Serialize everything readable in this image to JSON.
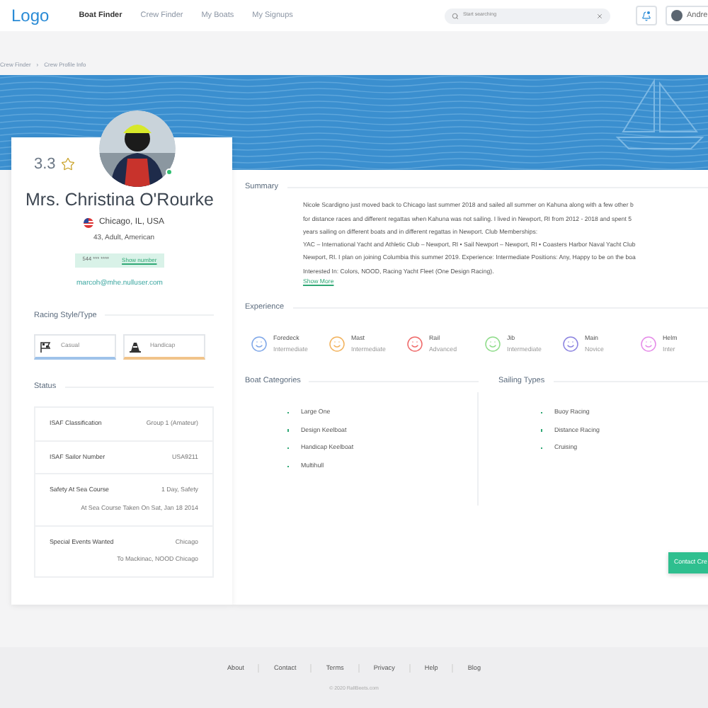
{
  "header": {
    "logo": "Logo",
    "nav": [
      {
        "label": "Boat Finder",
        "selected": true
      },
      {
        "label": "Crew Finder",
        "selected": false
      },
      {
        "label": "My Boats",
        "selected": false
      },
      {
        "label": "My Signups",
        "selected": false
      }
    ],
    "search": {
      "placeholder": "Start searching"
    },
    "user": {
      "name": "Andre"
    }
  },
  "breadcrumb": [
    "Crew Finder",
    "›",
    "Crew Profile Info"
  ],
  "profile": {
    "rating": "3.3",
    "name": "Mrs. Christina O'Rourke",
    "location": "Chicago, IL, USA",
    "details": "43, Adult, American",
    "phone": "544 *** ****",
    "show_number": "Show number",
    "email": "marcoh@mhe.nulluser.com",
    "online": true
  },
  "racing_style": {
    "title": "Racing Style/Type",
    "items": [
      {
        "label": "Casual",
        "color": "#9fc3ea",
        "kind": "flag"
      },
      {
        "label": "Handicap",
        "color": "#f1c48a",
        "kind": "cone"
      }
    ]
  },
  "status": {
    "title": "Status",
    "rows": [
      {
        "label": "ISAF Classification",
        "value": "Group 1 (Amateur)"
      },
      {
        "label": "ISAF Sailor Number",
        "value": "USA9211"
      },
      {
        "label": "Safety At Sea Course",
        "value": "1 Day, Safety",
        "value_2": "At Sea Course Taken On Sat, Jan 18 2014"
      },
      {
        "label": "Special Events Wanted",
        "value": "Chicago",
        "value_2": "To Mackinac, NOOD Chicago"
      }
    ]
  },
  "summary": {
    "title": "Summary",
    "lines": [
      "Nicole Scardigno just moved back to Chicago last summer 2018 and sailed all summer on Kahuna along with a few other b",
      "for distance races and different regattas when Kahuna was not sailing. I lived in Newport, RI from 2012 - 2018 and spent 5",
      "years sailing on different boats and in different regattas in Newport. Club Memberships:",
      "YAC – International Yacht and Athletic Club – Newport, RI • Sail Newport – Newport, RI • Coasters Harbor Naval Yacht Club",
      "Newport, RI. I plan on joining Columbia this summer 2019. Experience: Intermediate Positions: Any, Happy to be on the boa",
      "Interested In: Colors, NOOD, Racing Yacht Fleet (One Design Racing)."
    ],
    "more": "Show More"
  },
  "experience": {
    "title": "Experience",
    "items": [
      {
        "position": "Foredeck",
        "rank": "Intermediate",
        "color": "#7fa7e8"
      },
      {
        "position": "Mast",
        "rank": "Intermediate",
        "color": "#f2b35e"
      },
      {
        "position": "Rail",
        "rank": "Advanced",
        "color": "#ef6a6a"
      },
      {
        "position": "Jib",
        "rank": "Intermediate",
        "color": "#8fdc8a"
      },
      {
        "position": "Main",
        "rank": "Novice",
        "color": "#8c84e0"
      },
      {
        "position": "Helm",
        "rank": "Inter",
        "color": "#e58be8"
      }
    ]
  },
  "boat_categories": {
    "title": "Boat Categories",
    "items": [
      "Large One",
      "Design Keelboat",
      "Handicap Keelboat",
      "Multihull"
    ]
  },
  "sailing_types": {
    "title": "Sailing Types",
    "items": [
      "Buoy Racing",
      "Distance Racing",
      "Cruising"
    ]
  },
  "contact_button": "Contact Cre",
  "footer": {
    "links": [
      "About",
      "Contact",
      "Terms",
      "Privacy",
      "Help",
      "Blog"
    ],
    "copyright": "© 2020 RallBeets.com"
  }
}
